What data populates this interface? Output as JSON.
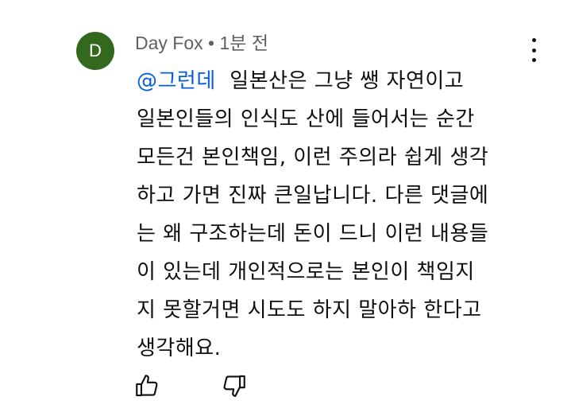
{
  "author": {
    "initial": "D",
    "name": "Day Fox",
    "separator": "•",
    "time": "1분 전",
    "avatar_color": "#33691e"
  },
  "comment": {
    "mention": "@그런데",
    "lines": [
      "일본산은 그냥 쌩 자연이고",
      "일본인들의 인식도 산에 들어서는 순간",
      "모든건 본인책임, 이런 주의라 쉽게 생각",
      "하고 가면 진짜 큰일납니다. 다른 댓글에",
      "는 왜 구조하는데 돈이 드니 이런 내용들",
      "이 있는데 개인적으로는 본인이 책임지",
      "지 못할거면 시도도 하지 말아하 한다고",
      "생각해요."
    ]
  },
  "icons": {
    "more": "more-vertical-icon",
    "like": "thumbs-up-icon",
    "dislike": "thumbs-down-icon"
  }
}
